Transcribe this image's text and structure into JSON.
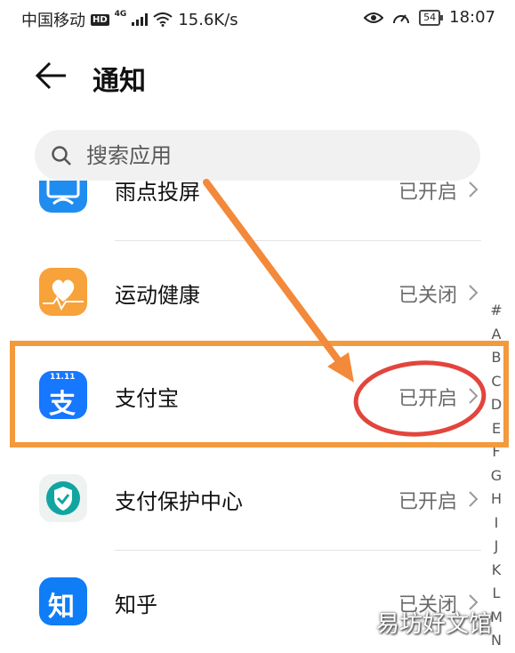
{
  "status_bar": {
    "carrier": "中国移动",
    "hd": "HD",
    "network": "4G",
    "speed": "15.6K/s",
    "battery": "54",
    "time": "18:07"
  },
  "header": {
    "title": "通知",
    "back_icon": "arrow-left-icon"
  },
  "search": {
    "placeholder": "搜索应用",
    "value": ""
  },
  "apps": [
    {
      "name": "雨点投屏",
      "status": "已开启",
      "icon": "screen-cast-app-icon",
      "color": "#1f8cf0"
    },
    {
      "name": "运动健康",
      "status": "已关闭",
      "icon": "health-app-icon",
      "color": "#f7a23a"
    },
    {
      "name": "支付宝",
      "status": "已开启",
      "icon": "alipay-app-icon",
      "color": "#1677ff",
      "badge": "11.11",
      "glyph": "支"
    },
    {
      "name": "支付保护中心",
      "status": "已开启",
      "icon": "payment-protection-app-icon",
      "color": "#10a5a0"
    },
    {
      "name": "知乎",
      "status": "已关闭",
      "icon": "zhihu-app-icon",
      "color": "#0f7df5",
      "glyph": "知"
    }
  ],
  "alphabet_index": [
    "#",
    "A",
    "B",
    "C",
    "D",
    "E",
    "F",
    "G",
    "H",
    "I",
    "J",
    "K",
    "L",
    "M",
    "N"
  ],
  "watermark": "易坊好文馆",
  "annotation_colors": {
    "box": "#f39a3d",
    "arrow": "#f3893a",
    "ellipse": "#e2453c"
  }
}
